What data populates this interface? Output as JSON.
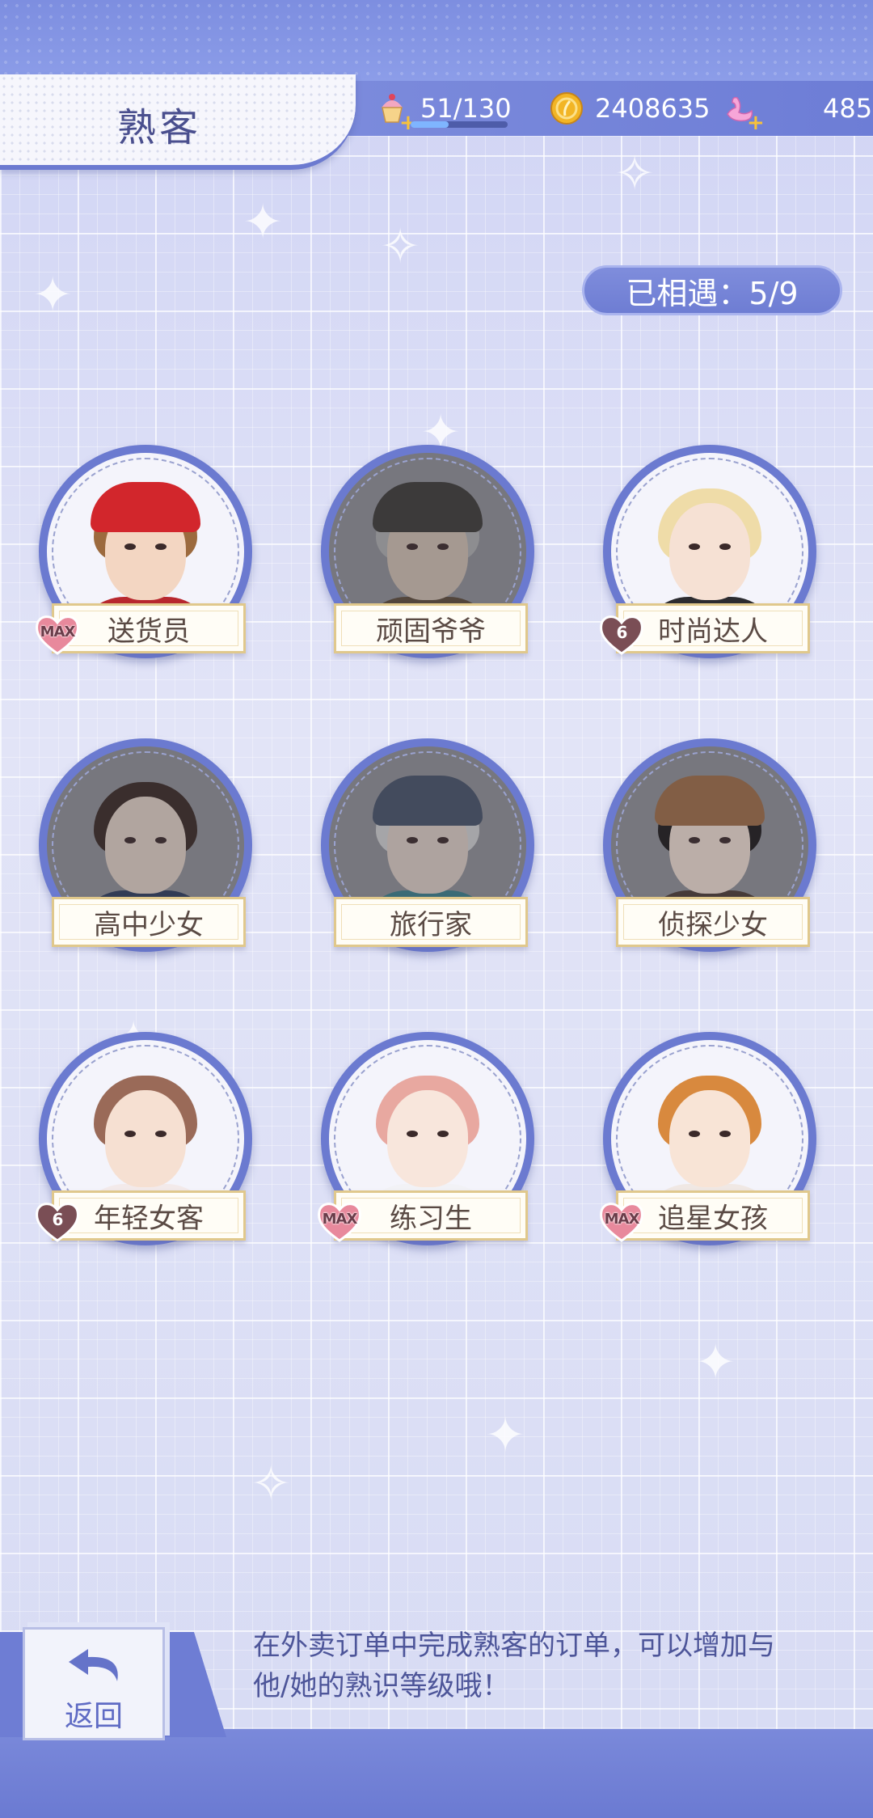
{
  "header": {
    "title": "熟客",
    "stamina": {
      "text": "51/130",
      "current": 51,
      "max": 130
    },
    "coins": "2408635",
    "gems": "485"
  },
  "encounter": {
    "text": "已相遇：5/9",
    "met": 5,
    "total": 9
  },
  "customers": [
    {
      "name": "送货员",
      "level_badge": "MAX",
      "met": true
    },
    {
      "name": "顽固爷爷",
      "level_badge": "",
      "met": false
    },
    {
      "name": "时尚达人",
      "level_badge": "6",
      "met": true
    },
    {
      "name": "高中少女",
      "level_badge": "",
      "met": false
    },
    {
      "name": "旅行家",
      "level_badge": "",
      "met": false
    },
    {
      "name": "侦探少女",
      "level_badge": "",
      "met": false
    },
    {
      "name": "年轻女客",
      "level_badge": "6",
      "met": true
    },
    {
      "name": "练习生",
      "level_badge": "MAX",
      "met": true
    },
    {
      "name": "追星女孩",
      "level_badge": "MAX",
      "met": true
    }
  ],
  "footer": {
    "back_label": "返回",
    "hint_line1": "在外卖订单中完成熟客的订单，可以增加与",
    "hint_line2": "他/她的熟识等级哦！"
  },
  "colors": {
    "accent": "#6d7dd6",
    "title_text": "#4a4f8e",
    "nameplate_border": "#e0c88c",
    "heart_pink": "#e8899c",
    "heart_brown": "#7a4e55"
  },
  "icons": {
    "stamina": "cupcake-icon",
    "coins": "coin-icon",
    "gems": "swan-icon",
    "back": "return-arrow-icon"
  }
}
